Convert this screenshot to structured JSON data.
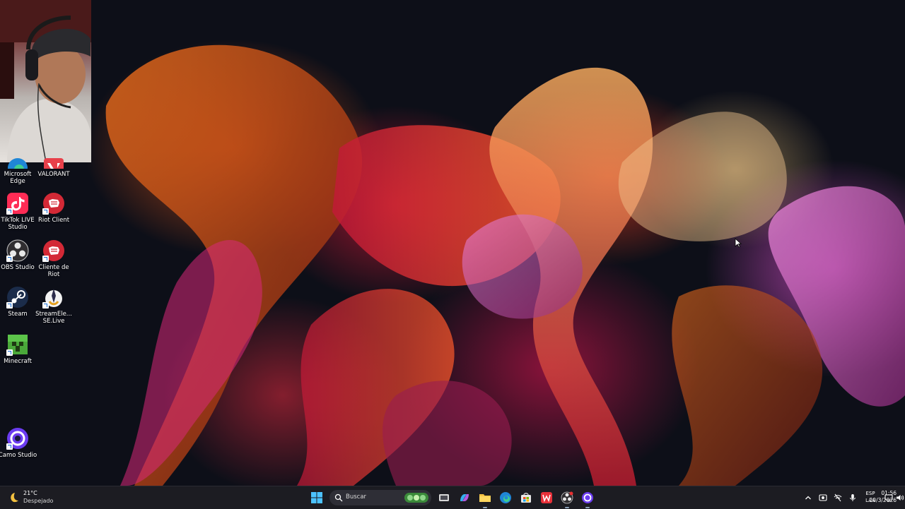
{
  "desktop": {
    "icons": [
      {
        "label": "Microsoft Edge",
        "icon": "edge-icon"
      },
      {
        "label": "VALORANT",
        "icon": "valorant-icon"
      },
      {
        "label": "TikTok LIVE Studio",
        "icon": "tiktok-icon"
      },
      {
        "label": "Riot Client",
        "icon": "riot-fist-icon"
      },
      {
        "label": "OBS Studio",
        "icon": "obs-icon"
      },
      {
        "label": "Cliente de Riot",
        "icon": "riot-fist-icon"
      },
      {
        "label": "Steam",
        "icon": "steam-icon"
      },
      {
        "label": "StreamEle... SE.Live",
        "icon": "streamelements-icon"
      },
      {
        "label": "Minecraft",
        "icon": "minecraft-icon"
      },
      {
        "label": "Camo Studio",
        "icon": "camo-icon"
      }
    ]
  },
  "taskbar": {
    "weather": {
      "temp": "21°C",
      "condition": "Despejado",
      "icon": "moon-icon"
    },
    "search_placeholder": "Buscar",
    "language": {
      "line1": "ESP",
      "line2": "LAA"
    },
    "clock": {
      "time": "01:56",
      "date": "20/3/2026"
    }
  },
  "colors": {
    "taskbar_bg": "#1c1c22",
    "accent": "#4cc2ff"
  }
}
